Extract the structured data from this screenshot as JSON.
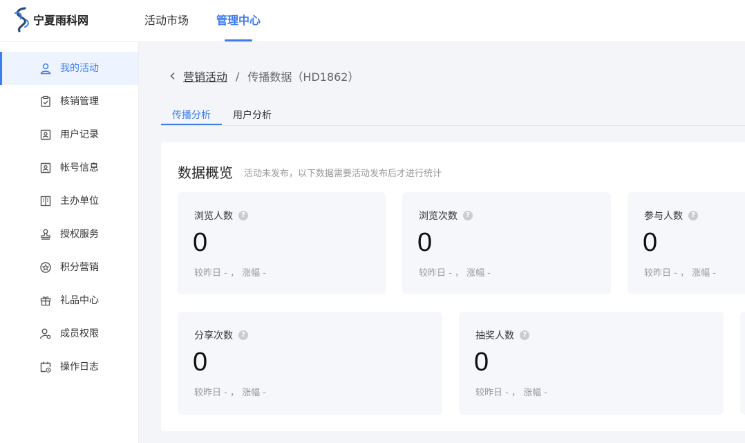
{
  "header": {
    "logo_text": "宁夏雨科网",
    "nav": [
      {
        "label": "活动市场"
      },
      {
        "label": "管理中心"
      }
    ]
  },
  "sidebar": {
    "items": [
      {
        "label": "我的活动",
        "icon": "user-icon"
      },
      {
        "label": "核销管理",
        "icon": "clipboard-check-icon"
      },
      {
        "label": "用户记录",
        "icon": "user-card-icon"
      },
      {
        "label": "帐号信息",
        "icon": "account-card-icon"
      },
      {
        "label": "主办单位",
        "icon": "building-icon"
      },
      {
        "label": "授权服务",
        "icon": "stamp-icon"
      },
      {
        "label": "积分营销",
        "icon": "star-badge-icon"
      },
      {
        "label": "礼品中心",
        "icon": "gift-icon"
      },
      {
        "label": "成员权限",
        "icon": "user-settings-icon"
      },
      {
        "label": "操作日志",
        "icon": "calendar-clock-icon"
      }
    ]
  },
  "breadcrumb": {
    "parent": "营销活动",
    "separator": "/",
    "current": "传播数据（HD1862）"
  },
  "tabs": [
    {
      "label": "传播分析"
    },
    {
      "label": "用户分析"
    }
  ],
  "overview": {
    "title": "数据概览",
    "note": "活动未发布，以下数据需要活动发布后才进行统计",
    "help_glyph": "?",
    "cards": [
      {
        "title": "浏览人数",
        "value": "0",
        "footer": "较昨日 - ， 涨幅 -"
      },
      {
        "title": "浏览次数",
        "value": "0",
        "footer": "较昨日 - ， 涨幅 -"
      },
      {
        "title": "参与人数",
        "value": "0",
        "footer": "较昨日 - ， 涨幅 -"
      },
      {
        "title": "分享次数",
        "value": "0",
        "footer": "较昨日 - ， 涨幅 -"
      },
      {
        "title": "抽奖人数",
        "value": "0",
        "footer": "较昨日 - ， 涨幅 -"
      }
    ]
  },
  "colors": {
    "accent": "#3b7cf0",
    "background": "#f3f5f9",
    "card_bg": "#f5f7fb"
  }
}
